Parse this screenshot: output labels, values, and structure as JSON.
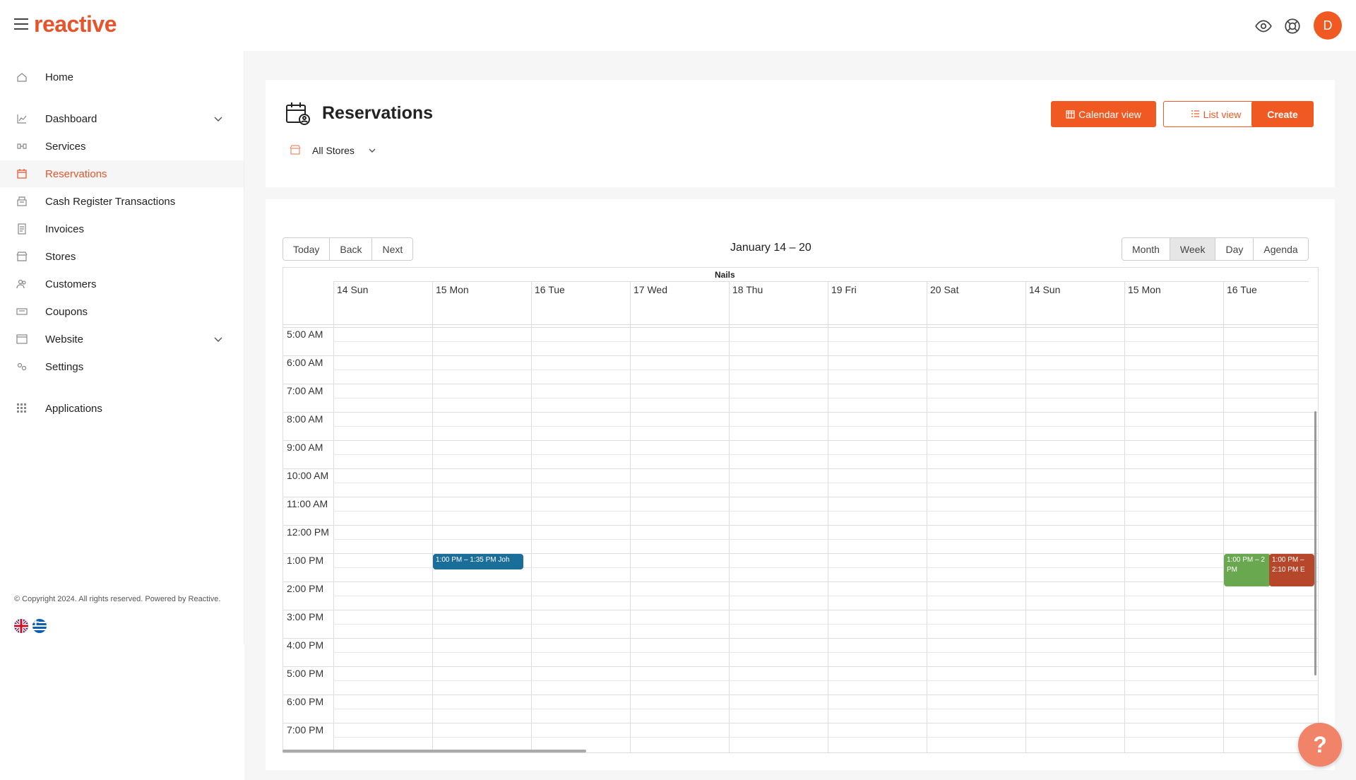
{
  "app": {
    "logo_text": "reactive",
    "user_initial": "D"
  },
  "sidebar": {
    "items": [
      {
        "label": "Home",
        "icon": "home-icon"
      },
      {
        "label": "Dashboard",
        "icon": "chart-icon"
      },
      {
        "label": "Services",
        "icon": "services-icon"
      },
      {
        "label": "Reservations",
        "icon": "calendar-icon"
      },
      {
        "label": "Cash Register Transactions",
        "icon": "register-icon"
      },
      {
        "label": "Invoices",
        "icon": "invoice-icon"
      },
      {
        "label": "Stores",
        "icon": "store-icon"
      },
      {
        "label": "Customers",
        "icon": "customers-icon"
      },
      {
        "label": "Coupons",
        "icon": "coupon-icon"
      },
      {
        "label": "Website",
        "icon": "website-icon"
      },
      {
        "label": "Settings",
        "icon": "settings-icon"
      },
      {
        "label": "Applications",
        "icon": "grid-icon"
      }
    ],
    "copyright": "© Copyright 2024. All rights reserved. Powered by Reactive."
  },
  "page": {
    "title": "Reservations",
    "calendar_view_label": "Calendar view",
    "list_view_label": "List view",
    "create_label": "Create",
    "store_filter": "All Stores"
  },
  "calendar": {
    "nav": [
      "Today",
      "Back",
      "Next"
    ],
    "range": "January 14 – 20",
    "views": [
      "Month",
      "Week",
      "Day",
      "Agenda"
    ],
    "active_view": "Week",
    "resource": "Nails",
    "days": [
      "14 Sun",
      "15 Mon",
      "16 Tue",
      "17 Wed",
      "18 Thu",
      "19 Fri",
      "20 Sat",
      "14 Sun",
      "15 Mon",
      "16 Tue"
    ],
    "times": [
      "5:00 AM",
      "6:00 AM",
      "7:00 AM",
      "8:00 AM",
      "9:00 AM",
      "10:00 AM",
      "11:00 AM",
      "12:00 PM",
      "1:00 PM",
      "2:00 PM",
      "3:00 PM",
      "4:00 PM",
      "5:00 PM",
      "6:00 PM",
      "7:00 PM"
    ],
    "events": [
      {
        "text": "1:00 PM – 1:35 PM",
        "title": "Joh",
        "color": "#1b6e99"
      },
      {
        "text": "1:00 PM – 2 PM",
        "color": "#6aa84f"
      },
      {
        "text": "1:00 PM – 2:10 PM",
        "title": "E",
        "color": "#b7472a"
      }
    ]
  },
  "colors": {
    "accent": "#f05a22"
  }
}
